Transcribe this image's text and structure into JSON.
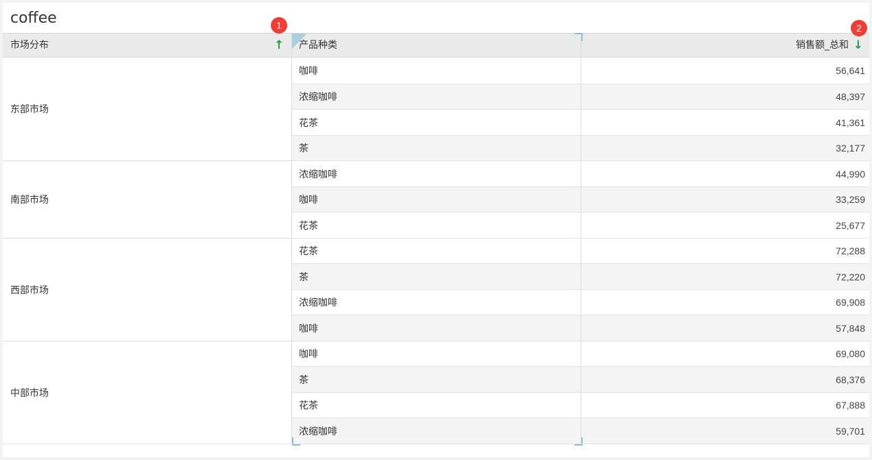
{
  "title": "coffee",
  "headers": {
    "market": "市场分布",
    "product": "产品种类",
    "sales": "销售额_总和",
    "market_sort": "↑",
    "sales_sort": "↓"
  },
  "badges": [
    "1",
    "2"
  ],
  "colors": {
    "sort_arrow": "#1f9b4f",
    "badge": "#ef3e36",
    "header_bg": "#eaeaea",
    "alt_row": "#f4f4f4",
    "selection": "#8fbfd0"
  },
  "groups": [
    {
      "market": "东部市场",
      "rows": [
        {
          "product": "咖啡",
          "sales": "56,641"
        },
        {
          "product": "浓缩咖啡",
          "sales": "48,397"
        },
        {
          "product": "花茶",
          "sales": "41,361"
        },
        {
          "product": "茶",
          "sales": "32,177"
        }
      ]
    },
    {
      "market": "南部市场",
      "rows": [
        {
          "product": "浓缩咖啡",
          "sales": "44,990"
        },
        {
          "product": "咖啡",
          "sales": "33,259"
        },
        {
          "product": "花茶",
          "sales": "25,677"
        }
      ]
    },
    {
      "market": "西部市场",
      "rows": [
        {
          "product": "花茶",
          "sales": "72,288"
        },
        {
          "product": "茶",
          "sales": "72,220"
        },
        {
          "product": "浓缩咖啡",
          "sales": "69,908"
        },
        {
          "product": "咖啡",
          "sales": "57,848"
        }
      ]
    },
    {
      "market": "中部市场",
      "rows": [
        {
          "product": "咖啡",
          "sales": "69,080"
        },
        {
          "product": "茶",
          "sales": "68,376"
        },
        {
          "product": "花茶",
          "sales": "67,888"
        },
        {
          "product": "浓缩咖啡",
          "sales": "59,701"
        }
      ]
    }
  ]
}
